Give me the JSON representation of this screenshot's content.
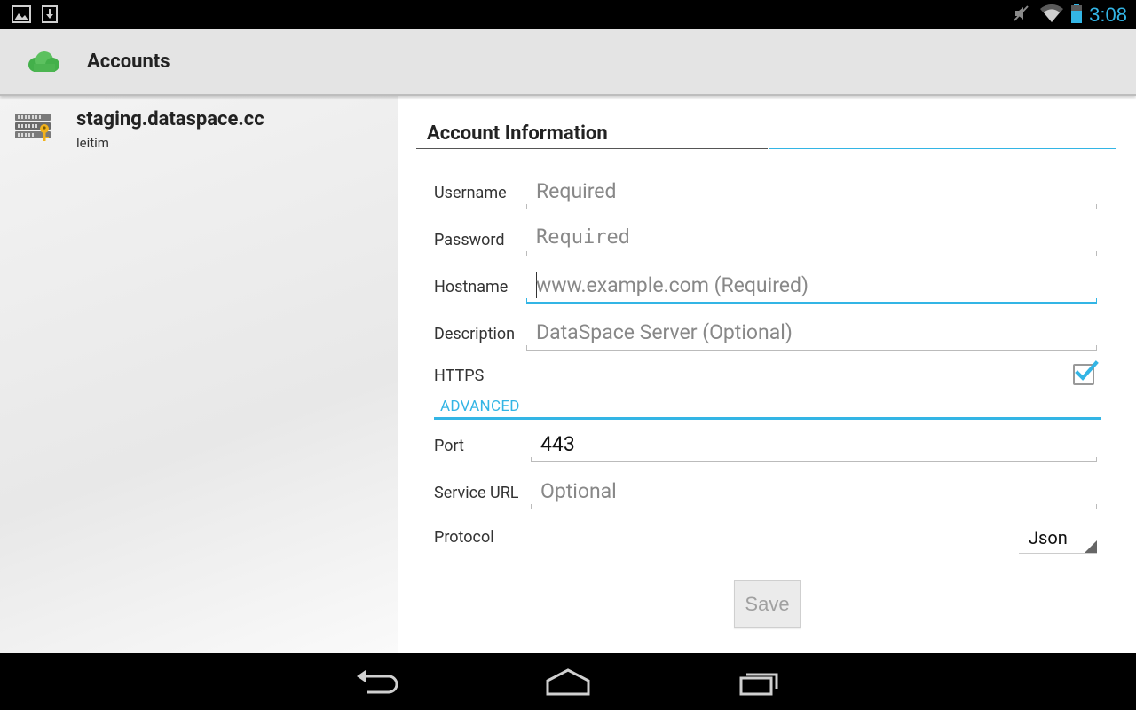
{
  "status_bar": {
    "time": "3:08",
    "left_icons": [
      "image-icon",
      "download-icon"
    ],
    "right_icons": [
      "mute-icon",
      "wifi-icon",
      "battery-icon"
    ],
    "accent": "#33b5e5"
  },
  "action_bar": {
    "title": "Accounts",
    "icon": "cloud-icon",
    "icon_color": "#4caf50"
  },
  "accounts": [
    {
      "host": "staging.dataspace.cc",
      "user": "leitim",
      "icon": "server-key-icon"
    }
  ],
  "form": {
    "section_title": "Account Information",
    "username": {
      "label": "Username",
      "placeholder": "Required",
      "value": ""
    },
    "password": {
      "label": "Password",
      "placeholder": "Required",
      "value": ""
    },
    "hostname": {
      "label": "Hostname",
      "placeholder": "www.example.com (Required)",
      "value": ""
    },
    "description": {
      "label": "Description",
      "placeholder": "DataSpace Server (Optional)",
      "value": ""
    },
    "https": {
      "label": "HTTPS",
      "checked": true
    },
    "advanced_label": "ADVANCED",
    "port": {
      "label": "Port",
      "value": "443"
    },
    "service_url": {
      "label": "Service URL",
      "placeholder": "Optional",
      "value": ""
    },
    "protocol": {
      "label": "Protocol",
      "value": "Json"
    },
    "save_label": "Save"
  },
  "nav_bar": {
    "buttons": [
      "back-icon",
      "home-icon",
      "recents-icon"
    ]
  }
}
